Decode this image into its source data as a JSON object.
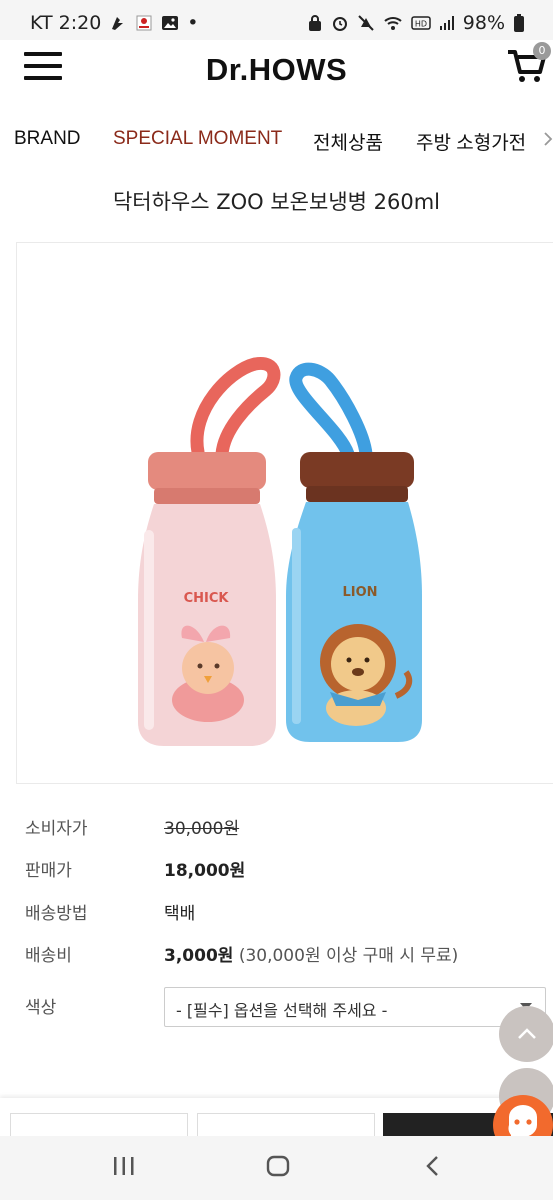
{
  "status_bar": {
    "carrier_time": "KT 2:20",
    "battery": "98%",
    "dot": "•"
  },
  "header": {
    "logo": "Dr.HOWS",
    "cart_count": "0"
  },
  "nav": {
    "items": [
      {
        "label": "BRAND",
        "color": "#111111"
      },
      {
        "label": "SPECIAL MOMENT",
        "color": "#8b2a1a"
      },
      {
        "label": "전체상품",
        "color": "#111111"
      },
      {
        "label": "주방 소형가전",
        "color": "#111111"
      }
    ]
  },
  "product": {
    "title": "닥터하우스 ZOO 보온보냉병 260ml",
    "bottle_left_text": "CHICK",
    "bottle_right_text": "LION"
  },
  "info": {
    "consumer_price_label": "소비자가",
    "consumer_price": "30,000원",
    "sale_price_label": "판매가",
    "sale_price": "18,000원",
    "shipping_method_label": "배송방법",
    "shipping_method": "택배",
    "shipping_fee_label": "배송비",
    "shipping_fee": "3,000원",
    "shipping_note": "(30,000원 이상 구매 시 무료)",
    "color_label": "색상",
    "color_placeholder": "- [필수] 옵션을 선택해 주세요 -"
  },
  "colors": {
    "accent_nav": "#8b2a1a",
    "chat": "#f26a2d",
    "pink_bottle": "#f3cfd2",
    "blue_bottle": "#6cc0ea"
  },
  "icons": [
    "menu-icon",
    "cart-icon",
    "chevron-up-icon",
    "chevron-down-icon",
    "chat-icon",
    "recents-icon",
    "home-icon",
    "back-icon"
  ]
}
